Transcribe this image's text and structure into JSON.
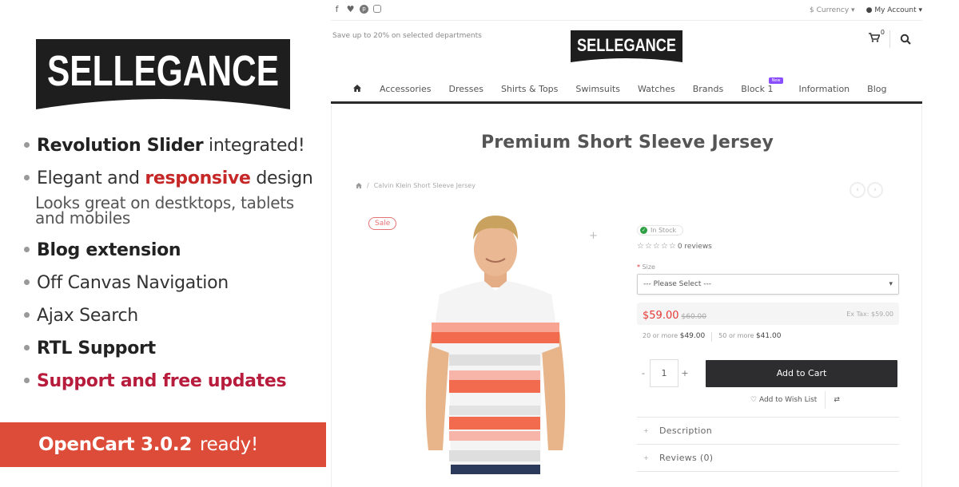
{
  "promo": {
    "logo_text": "SELLEGANCE",
    "features": [
      {
        "bold": "Revolution Slider",
        "rest": " integrated!"
      },
      {
        "pre": "Elegant and ",
        "highlight": "responsive",
        "post": " design"
      },
      {
        "sub1": "Looks great on destktops, tablets"
      },
      {
        "sub2": "and mobiles"
      },
      {
        "bold": "Blog extension"
      },
      {
        "plain": "Off Canvas Navigation"
      },
      {
        "plain": "Ajax Search"
      },
      {
        "bold": "RTL Support"
      },
      {
        "red": "Support and free updates"
      }
    ],
    "banner": {
      "strong": "OpenCart 3.0.2",
      "light": "ready!"
    },
    "colors": {
      "accent_red": "#dd4b39",
      "highlight_red": "#c62828"
    }
  },
  "store": {
    "social_icons": [
      "facebook-icon",
      "twitter-icon",
      "pinterest-icon",
      "instagram-icon"
    ],
    "currency_label": "$ Currency",
    "account_label": "My Account",
    "promo_text": "Save up to 20% on selected departments",
    "logo_text": "SELLEGANCE",
    "cart_count": "0",
    "nav": {
      "items": [
        "Accessories",
        "Dresses",
        "Shirts & Tops",
        "Swimsuits",
        "Watches",
        "Brands",
        "Block 1",
        "Information",
        "Blog"
      ],
      "badge": "New"
    },
    "product": {
      "title": "Premium Short Sleeve Jersey",
      "breadcrumb": "Calvin Klein Short Sleeve Jersey",
      "sale_badge": "Sale",
      "stock": "In Stock",
      "stars": "☆☆☆☆☆",
      "reviews_count": "0 reviews",
      "size_label": "Size",
      "size_placeholder": "--- Please Select ---",
      "price_new": "$59.00",
      "price_old": "$60.00",
      "ex_tax": "Ex Tax: $59.00",
      "discounts": [
        {
          "label": "20 or more",
          "price": "$49.00"
        },
        {
          "label": "50 or more",
          "price": "$41.00"
        }
      ],
      "quantity": "1",
      "qty_minus": "-",
      "qty_plus": "+",
      "add_to_cart": "Add to Cart",
      "wishlist": "Add to Wish List",
      "tabs": [
        "Description",
        "Reviews (0)"
      ]
    }
  }
}
